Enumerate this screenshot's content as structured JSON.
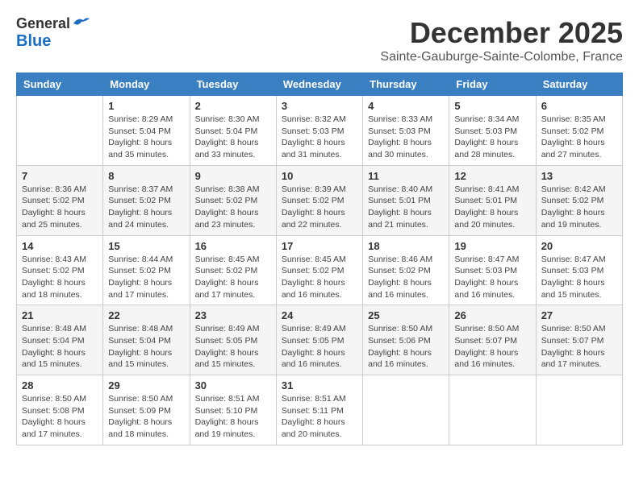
{
  "header": {
    "logo_line1": "General",
    "logo_line2": "Blue",
    "month": "December 2025",
    "location": "Sainte-Gauburge-Sainte-Colombe, France"
  },
  "days_of_week": [
    "Sunday",
    "Monday",
    "Tuesday",
    "Wednesday",
    "Thursday",
    "Friday",
    "Saturday"
  ],
  "weeks": [
    [
      {
        "day": "",
        "sunrise": "",
        "sunset": "",
        "daylight": ""
      },
      {
        "day": "1",
        "sunrise": "Sunrise: 8:29 AM",
        "sunset": "Sunset: 5:04 PM",
        "daylight": "Daylight: 8 hours and 35 minutes."
      },
      {
        "day": "2",
        "sunrise": "Sunrise: 8:30 AM",
        "sunset": "Sunset: 5:04 PM",
        "daylight": "Daylight: 8 hours and 33 minutes."
      },
      {
        "day": "3",
        "sunrise": "Sunrise: 8:32 AM",
        "sunset": "Sunset: 5:03 PM",
        "daylight": "Daylight: 8 hours and 31 minutes."
      },
      {
        "day": "4",
        "sunrise": "Sunrise: 8:33 AM",
        "sunset": "Sunset: 5:03 PM",
        "daylight": "Daylight: 8 hours and 30 minutes."
      },
      {
        "day": "5",
        "sunrise": "Sunrise: 8:34 AM",
        "sunset": "Sunset: 5:03 PM",
        "daylight": "Daylight: 8 hours and 28 minutes."
      },
      {
        "day": "6",
        "sunrise": "Sunrise: 8:35 AM",
        "sunset": "Sunset: 5:02 PM",
        "daylight": "Daylight: 8 hours and 27 minutes."
      }
    ],
    [
      {
        "day": "7",
        "sunrise": "Sunrise: 8:36 AM",
        "sunset": "Sunset: 5:02 PM",
        "daylight": "Daylight: 8 hours and 25 minutes."
      },
      {
        "day": "8",
        "sunrise": "Sunrise: 8:37 AM",
        "sunset": "Sunset: 5:02 PM",
        "daylight": "Daylight: 8 hours and 24 minutes."
      },
      {
        "day": "9",
        "sunrise": "Sunrise: 8:38 AM",
        "sunset": "Sunset: 5:02 PM",
        "daylight": "Daylight: 8 hours and 23 minutes."
      },
      {
        "day": "10",
        "sunrise": "Sunrise: 8:39 AM",
        "sunset": "Sunset: 5:02 PM",
        "daylight": "Daylight: 8 hours and 22 minutes."
      },
      {
        "day": "11",
        "sunrise": "Sunrise: 8:40 AM",
        "sunset": "Sunset: 5:01 PM",
        "daylight": "Daylight: 8 hours and 21 minutes."
      },
      {
        "day": "12",
        "sunrise": "Sunrise: 8:41 AM",
        "sunset": "Sunset: 5:01 PM",
        "daylight": "Daylight: 8 hours and 20 minutes."
      },
      {
        "day": "13",
        "sunrise": "Sunrise: 8:42 AM",
        "sunset": "Sunset: 5:02 PM",
        "daylight": "Daylight: 8 hours and 19 minutes."
      }
    ],
    [
      {
        "day": "14",
        "sunrise": "Sunrise: 8:43 AM",
        "sunset": "Sunset: 5:02 PM",
        "daylight": "Daylight: 8 hours and 18 minutes."
      },
      {
        "day": "15",
        "sunrise": "Sunrise: 8:44 AM",
        "sunset": "Sunset: 5:02 PM",
        "daylight": "Daylight: 8 hours and 17 minutes."
      },
      {
        "day": "16",
        "sunrise": "Sunrise: 8:45 AM",
        "sunset": "Sunset: 5:02 PM",
        "daylight": "Daylight: 8 hours and 17 minutes."
      },
      {
        "day": "17",
        "sunrise": "Sunrise: 8:45 AM",
        "sunset": "Sunset: 5:02 PM",
        "daylight": "Daylight: 8 hours and 16 minutes."
      },
      {
        "day": "18",
        "sunrise": "Sunrise: 8:46 AM",
        "sunset": "Sunset: 5:02 PM",
        "daylight": "Daylight: 8 hours and 16 minutes."
      },
      {
        "day": "19",
        "sunrise": "Sunrise: 8:47 AM",
        "sunset": "Sunset: 5:03 PM",
        "daylight": "Daylight: 8 hours and 16 minutes."
      },
      {
        "day": "20",
        "sunrise": "Sunrise: 8:47 AM",
        "sunset": "Sunset: 5:03 PM",
        "daylight": "Daylight: 8 hours and 15 minutes."
      }
    ],
    [
      {
        "day": "21",
        "sunrise": "Sunrise: 8:48 AM",
        "sunset": "Sunset: 5:04 PM",
        "daylight": "Daylight: 8 hours and 15 minutes."
      },
      {
        "day": "22",
        "sunrise": "Sunrise: 8:48 AM",
        "sunset": "Sunset: 5:04 PM",
        "daylight": "Daylight: 8 hours and 15 minutes."
      },
      {
        "day": "23",
        "sunrise": "Sunrise: 8:49 AM",
        "sunset": "Sunset: 5:05 PM",
        "daylight": "Daylight: 8 hours and 15 minutes."
      },
      {
        "day": "24",
        "sunrise": "Sunrise: 8:49 AM",
        "sunset": "Sunset: 5:05 PM",
        "daylight": "Daylight: 8 hours and 16 minutes."
      },
      {
        "day": "25",
        "sunrise": "Sunrise: 8:50 AM",
        "sunset": "Sunset: 5:06 PM",
        "daylight": "Daylight: 8 hours and 16 minutes."
      },
      {
        "day": "26",
        "sunrise": "Sunrise: 8:50 AM",
        "sunset": "Sunset: 5:07 PM",
        "daylight": "Daylight: 8 hours and 16 minutes."
      },
      {
        "day": "27",
        "sunrise": "Sunrise: 8:50 AM",
        "sunset": "Sunset: 5:07 PM",
        "daylight": "Daylight: 8 hours and 17 minutes."
      }
    ],
    [
      {
        "day": "28",
        "sunrise": "Sunrise: 8:50 AM",
        "sunset": "Sunset: 5:08 PM",
        "daylight": "Daylight: 8 hours and 17 minutes."
      },
      {
        "day": "29",
        "sunrise": "Sunrise: 8:50 AM",
        "sunset": "Sunset: 5:09 PM",
        "daylight": "Daylight: 8 hours and 18 minutes."
      },
      {
        "day": "30",
        "sunrise": "Sunrise: 8:51 AM",
        "sunset": "Sunset: 5:10 PM",
        "daylight": "Daylight: 8 hours and 19 minutes."
      },
      {
        "day": "31",
        "sunrise": "Sunrise: 8:51 AM",
        "sunset": "Sunset: 5:11 PM",
        "daylight": "Daylight: 8 hours and 20 minutes."
      },
      {
        "day": "",
        "sunrise": "",
        "sunset": "",
        "daylight": ""
      },
      {
        "day": "",
        "sunrise": "",
        "sunset": "",
        "daylight": ""
      },
      {
        "day": "",
        "sunrise": "",
        "sunset": "",
        "daylight": ""
      }
    ]
  ]
}
